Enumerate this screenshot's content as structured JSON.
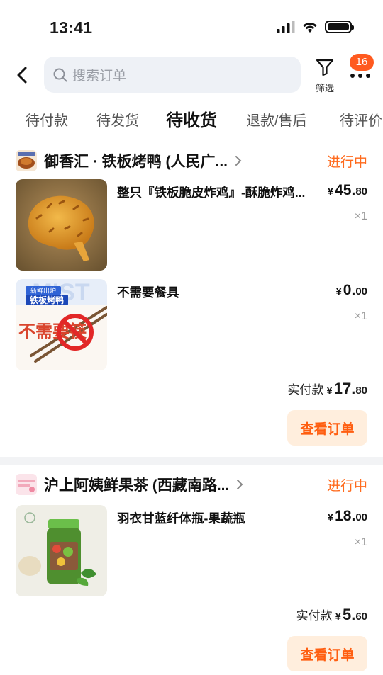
{
  "status_bar": {
    "time": "13:41"
  },
  "header": {
    "search_placeholder": "搜索订单",
    "filter_label": "筛选",
    "badge_count": "16"
  },
  "tabs": [
    {
      "label": "待付款",
      "active": false
    },
    {
      "label": "待发货",
      "active": false
    },
    {
      "label": "待收货",
      "active": true
    },
    {
      "label": "退款/售后",
      "active": false
    },
    {
      "label": "待评价",
      "active": false
    }
  ],
  "orders": [
    {
      "store_name": "御香汇 · 铁板烤鸭 (人民广...",
      "status": "进行中",
      "items": [
        {
          "name": "整只『铁板脆皮炸鸡』-酥脆炸鸡...",
          "price_int": "45.",
          "price_dec": "80",
          "qty": "×1"
        },
        {
          "name": "不需要餐具",
          "price_int": "0.",
          "price_dec": "00",
          "qty": "×1",
          "thumb_text_1": "新鲜出炉",
          "thumb_text_2": "铁板烤鸭",
          "thumb_text_3": "不需要筷"
        }
      ],
      "paid_label": "实付款",
      "paid_int": "17.",
      "paid_dec": "80",
      "button": "查看订单"
    },
    {
      "store_name": "沪上阿姨鲜果茶 (西藏南路...",
      "status": "进行中",
      "items": [
        {
          "name": "羽衣甘蓝纤体瓶-果蔬瓶",
          "price_int": "18.",
          "price_dec": "00",
          "qty": "×1"
        }
      ],
      "paid_label": "实付款",
      "paid_int": "5.",
      "paid_dec": "60",
      "button": "查看订单"
    }
  ],
  "currency_symbol": "¥",
  "colors": {
    "accent": "#ff6a1c",
    "button_bg": "#ffeedd",
    "badge": "#ff5a1f",
    "search_bg": "#eef1f6"
  }
}
